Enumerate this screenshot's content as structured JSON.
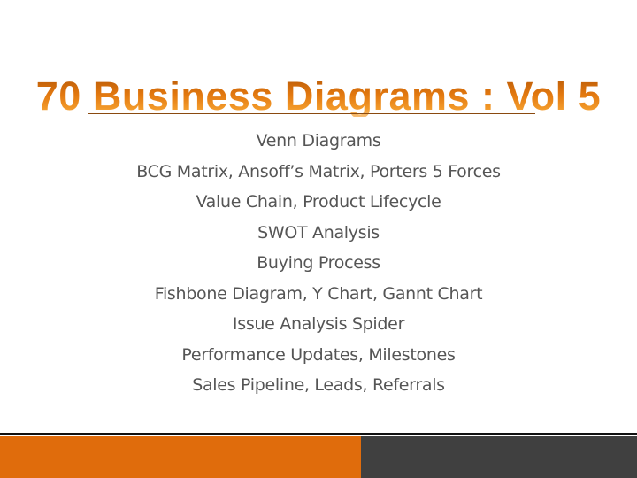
{
  "slide": {
    "title": "70 Business Diagrams : Vol 5",
    "topics": [
      "Venn Diagrams",
      "BCG Matrix, Ansoff’s Matrix, Porters 5 Forces",
      "Value Chain, Product Lifecycle",
      "SWOT Analysis",
      "Buying Process",
      "Fishbone Diagram, Y Chart, Gannt Chart",
      "Issue Analysis Spider",
      "Performance Updates, Milestones",
      "Sales Pipeline, Leads, Referrals"
    ]
  },
  "colors": {
    "accent_orange": "#e06c0c",
    "footer_dark": "#404040",
    "body_text": "#555555"
  }
}
